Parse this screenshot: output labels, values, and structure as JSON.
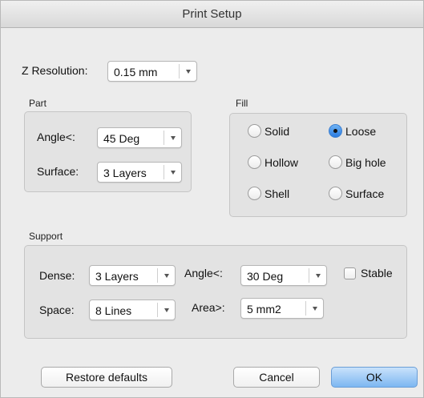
{
  "window": {
    "title": "Print Setup"
  },
  "z_resolution": {
    "label": "Z Resolution:",
    "value": "0.15 mm"
  },
  "part": {
    "title": "Part",
    "angle": {
      "label": "Angle<:",
      "value": "45 Deg"
    },
    "surface": {
      "label": "Surface:",
      "value": "3 Layers"
    }
  },
  "fill": {
    "title": "Fill",
    "options": [
      {
        "label": "Solid",
        "selected": false
      },
      {
        "label": "Loose",
        "selected": true
      },
      {
        "label": "Hollow",
        "selected": false
      },
      {
        "label": "Big hole",
        "selected": false
      },
      {
        "label": "Shell",
        "selected": false
      },
      {
        "label": "Surface",
        "selected": false
      }
    ]
  },
  "support": {
    "title": "Support",
    "dense": {
      "label": "Dense:",
      "value": "3 Layers"
    },
    "angle": {
      "label": "Angle<:",
      "value": "30 Deg"
    },
    "stable": {
      "label": "Stable",
      "checked": false
    },
    "space": {
      "label": "Space:",
      "value": "8 Lines"
    },
    "area": {
      "label": "Area>:",
      "value": "5 mm2"
    }
  },
  "buttons": {
    "restore": "Restore defaults",
    "cancel": "Cancel",
    "ok": "OK"
  },
  "colors": {
    "window_bg": "#ececec",
    "group_bg": "#e3e3e3",
    "default_button": "#7db7f1",
    "radio_selected": "#2a7be0"
  }
}
